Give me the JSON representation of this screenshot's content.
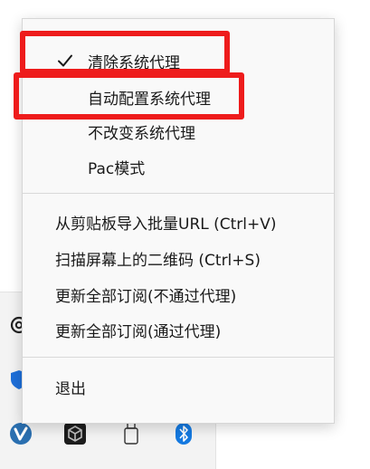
{
  "menu": {
    "proxy_items": [
      {
        "label": "清除系统代理",
        "checked": true
      },
      {
        "label": "自动配置系统代理",
        "checked": false
      },
      {
        "label": "不改变系统代理",
        "checked": false
      },
      {
        "label": "Pac模式",
        "checked": false
      }
    ],
    "subscription_items": [
      {
        "label": "从剪贴板导入批量URL (Ctrl+V)"
      },
      {
        "label": "扫描屏幕上的二维码 (Ctrl+S)"
      },
      {
        "label": "更新全部订阅(不通过代理)"
      },
      {
        "label": "更新全部订阅(通过代理)"
      }
    ],
    "exit_label": "退出"
  },
  "annotation": {
    "color": "#ee1c1c"
  },
  "tray": {
    "icons": [
      "openai-icon",
      "shield-icon",
      "v2ray-icon",
      "cube-app-icon",
      "usb-drive-icon",
      "bluetooth-icon"
    ]
  }
}
